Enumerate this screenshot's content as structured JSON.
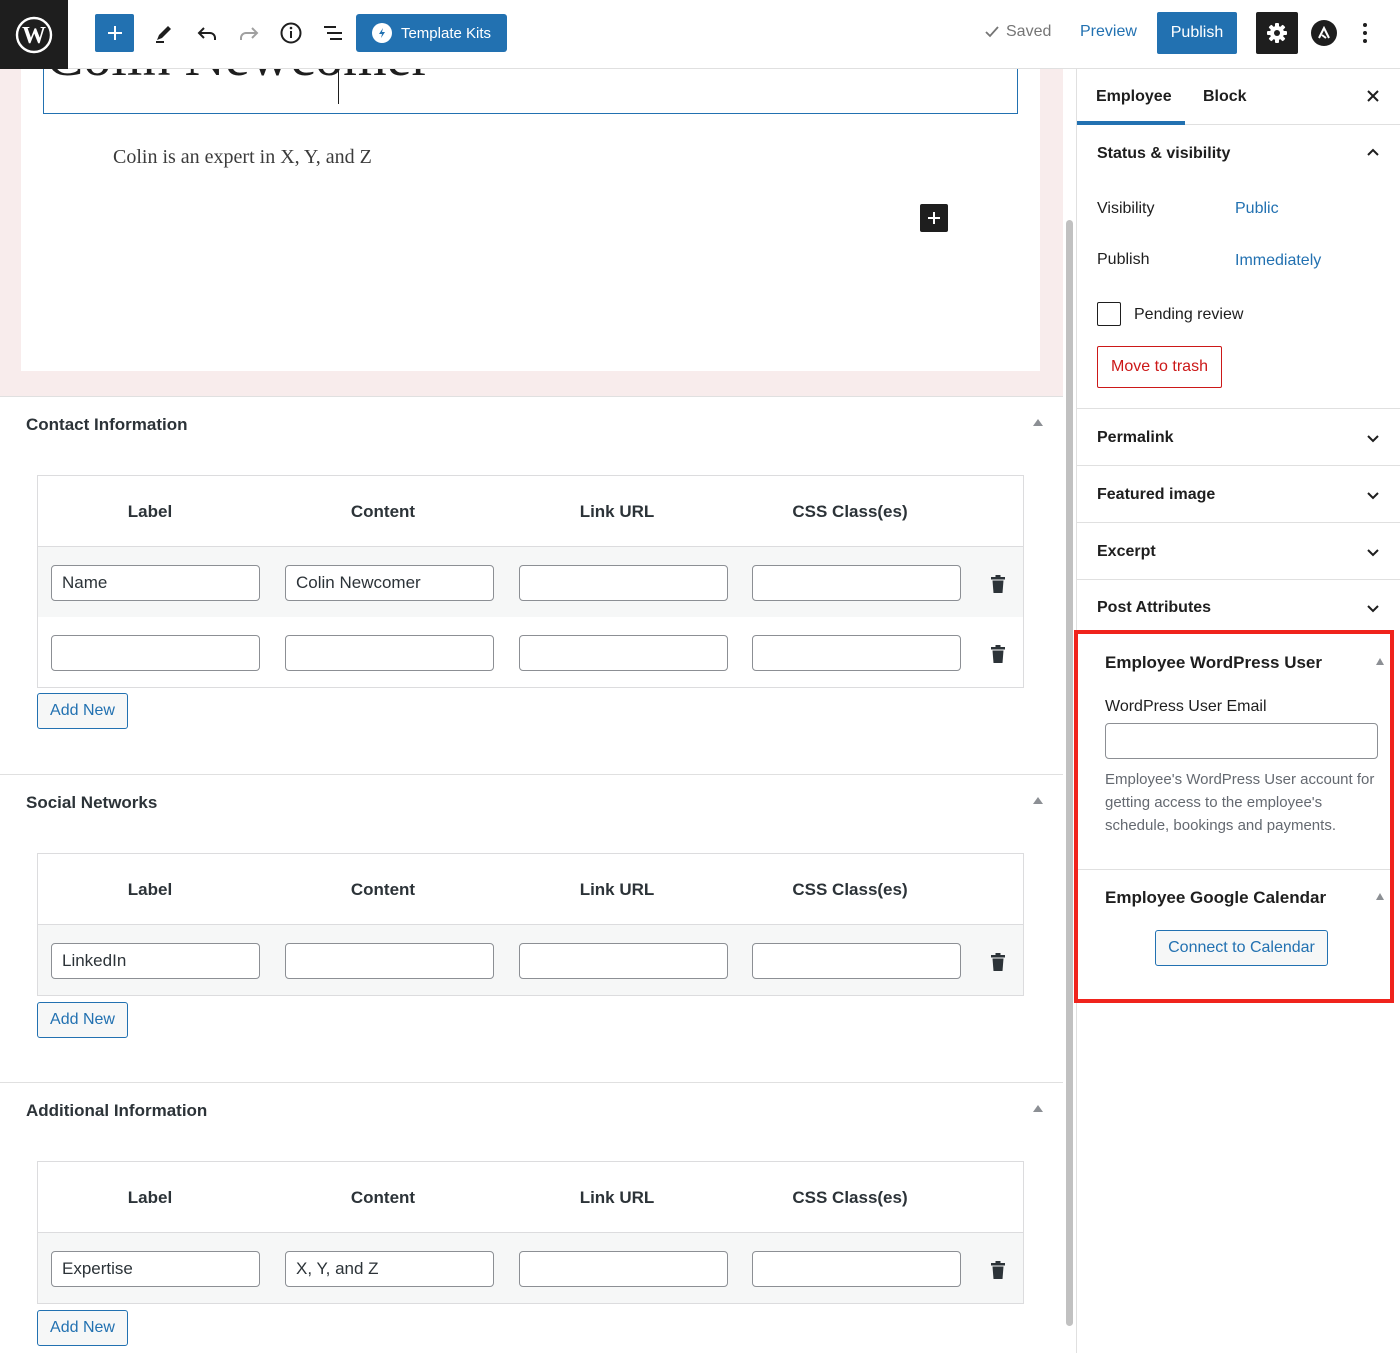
{
  "toolbar": {
    "template_kits_label": "Template Kits",
    "saved_label": "Saved",
    "preview_label": "Preview",
    "publish_label": "Publish"
  },
  "post": {
    "title": "Colin Newcomer",
    "lead": "Colin is an expert in X, Y, and Z"
  },
  "metaboxes": {
    "contact": {
      "title": "Contact Information",
      "columns": [
        "Label",
        "Content",
        "Link URL",
        "CSS Class(es)"
      ],
      "rows": [
        {
          "label": "Name",
          "content": "Colin Newcomer",
          "link": "",
          "css": ""
        },
        {
          "label": "",
          "content": "",
          "link": "",
          "css": ""
        }
      ],
      "add_new_label": "Add New"
    },
    "social": {
      "title": "Social Networks",
      "columns": [
        "Label",
        "Content",
        "Link URL",
        "CSS Class(es)"
      ],
      "rows": [
        {
          "label": "LinkedIn",
          "content": "",
          "link": "",
          "css": ""
        }
      ],
      "add_new_label": "Add New"
    },
    "additional": {
      "title": "Additional Information",
      "columns": [
        "Label",
        "Content",
        "Link URL",
        "CSS Class(es)"
      ],
      "rows": [
        {
          "label": "Expertise",
          "content": "X, Y, and Z",
          "link": "",
          "css": ""
        }
      ],
      "add_new_label": "Add New"
    }
  },
  "sidebar": {
    "tabs": [
      "Employee",
      "Block"
    ],
    "status_visibility": {
      "title": "Status & visibility",
      "visibility_label": "Visibility",
      "visibility_value": "Public",
      "publish_label": "Publish",
      "publish_value": "Immediately",
      "pending_review_label": "Pending review",
      "move_to_trash_label": "Move to trash"
    },
    "panels": [
      "Permalink",
      "Featured image",
      "Excerpt",
      "Post Attributes"
    ],
    "employee_user": {
      "title": "Employee WordPress User",
      "email_label": "WordPress User Email",
      "email_value": "",
      "description": "Employee's WordPress User account for getting access to the employee's schedule, bookings and payments."
    },
    "employee_calendar": {
      "title": "Employee Google Calendar",
      "button_label": "Connect to Calendar"
    }
  },
  "colors": {
    "accent": "#2271b1",
    "danger": "#cc1818",
    "highlight": "#f0231c"
  },
  "icons": [
    "wordpress-logo-icon",
    "plus-icon",
    "pencil-icon",
    "undo-icon",
    "redo-icon",
    "info-icon",
    "list-view-icon",
    "template-kits-icon",
    "check-icon",
    "gear-icon",
    "astra-icon",
    "more-vertical-icon",
    "close-icon",
    "chevron-up-icon",
    "chevron-down-icon",
    "trash-icon"
  ]
}
